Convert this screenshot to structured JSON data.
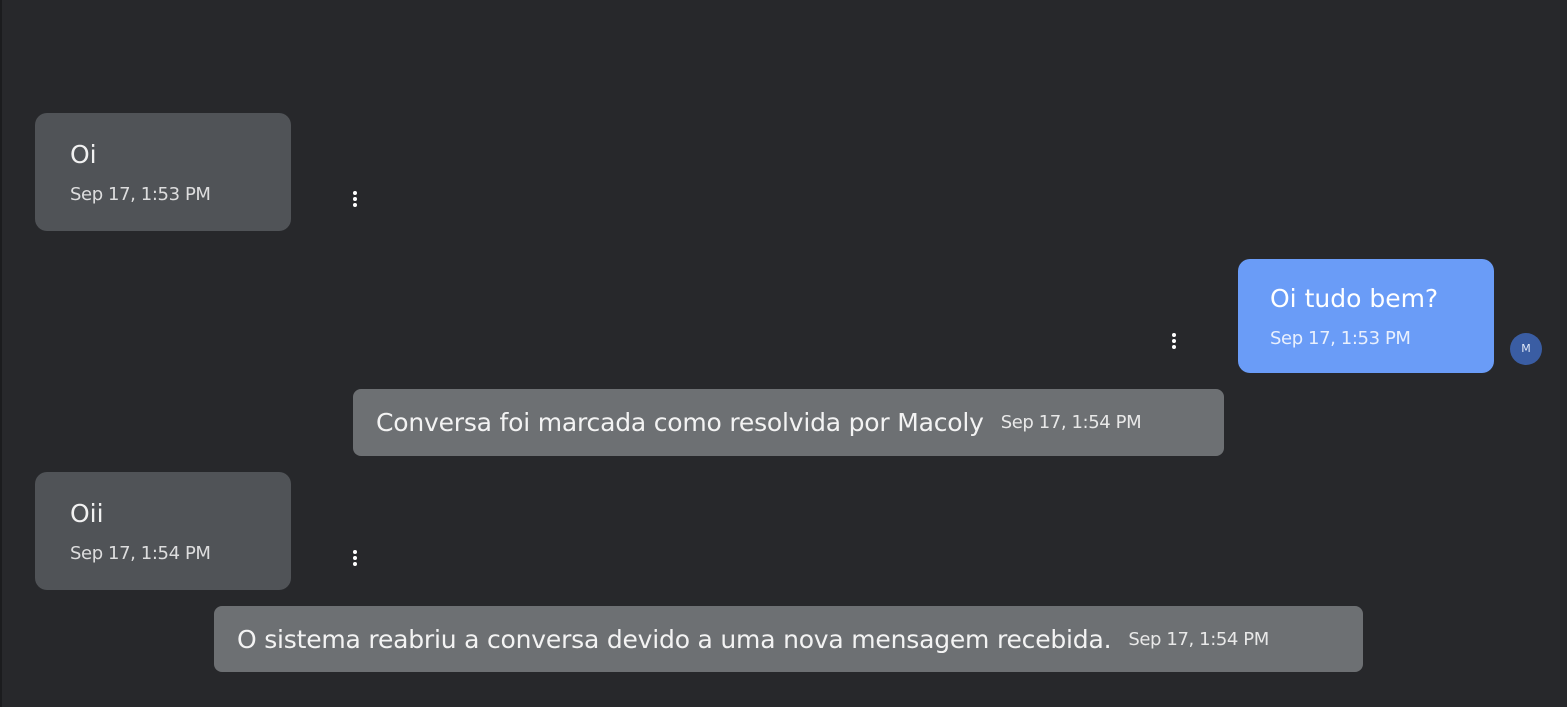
{
  "messages": [
    {
      "kind": "incoming",
      "text": "Oi",
      "time": "Sep 17, 1:53 PM"
    },
    {
      "kind": "outgoing",
      "text": "Oi tudo bem?",
      "time": "Sep 17, 1:53 PM",
      "avatar_initial": "M"
    },
    {
      "kind": "system",
      "text": "Conversa foi marcada como resolvida por Macoly",
      "time": "Sep 17, 1:54 PM"
    },
    {
      "kind": "incoming",
      "text": "Oii",
      "time": "Sep 17, 1:54 PM"
    },
    {
      "kind": "system",
      "text": "O sistema reabriu a conversa devido a uma nova mensagem recebida.",
      "time": "Sep 17, 1:54 PM"
    }
  ],
  "icons": {
    "message_menu": "more-vertical-icon"
  },
  "colors": {
    "background": "#27282b",
    "incoming_bubble": "#505357",
    "outgoing_bubble": "#6a9cf7",
    "system_bubble": "#6d7073",
    "avatar": "#3a5da3"
  }
}
